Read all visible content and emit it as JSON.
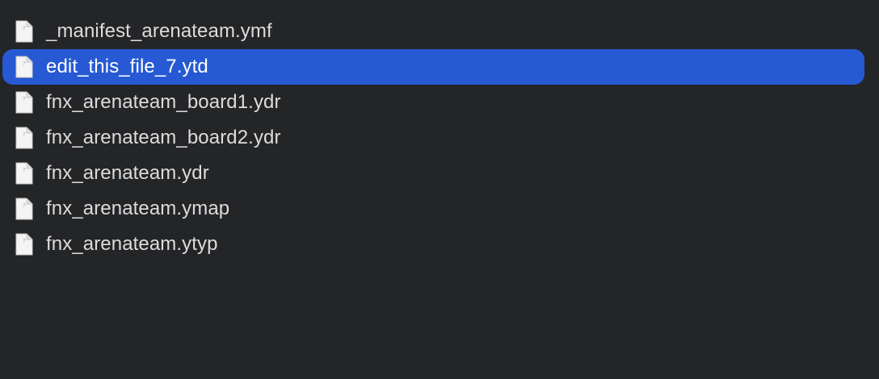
{
  "files": [
    {
      "name": "_manifest_arenateam.ymf",
      "selected": false,
      "icon": "generic-document-icon"
    },
    {
      "name": "edit_this_file_7.ytd",
      "selected": true,
      "icon": "generic-document-icon"
    },
    {
      "name": "fnx_arenateam_board1.ydr",
      "selected": false,
      "icon": "generic-document-icon"
    },
    {
      "name": "fnx_arenateam_board2.ydr",
      "selected": false,
      "icon": "generic-document-icon"
    },
    {
      "name": "fnx_arenateam.ydr",
      "selected": false,
      "icon": "generic-document-icon"
    },
    {
      "name": "fnx_arenateam.ymap",
      "selected": false,
      "icon": "generic-document-icon"
    },
    {
      "name": "fnx_arenateam.ytyp",
      "selected": false,
      "icon": "generic-document-icon"
    }
  ],
  "colors": {
    "background": "#242527",
    "selection": "#2659d3",
    "text": "#dcdcdd",
    "selected_text": "#ffffff"
  }
}
